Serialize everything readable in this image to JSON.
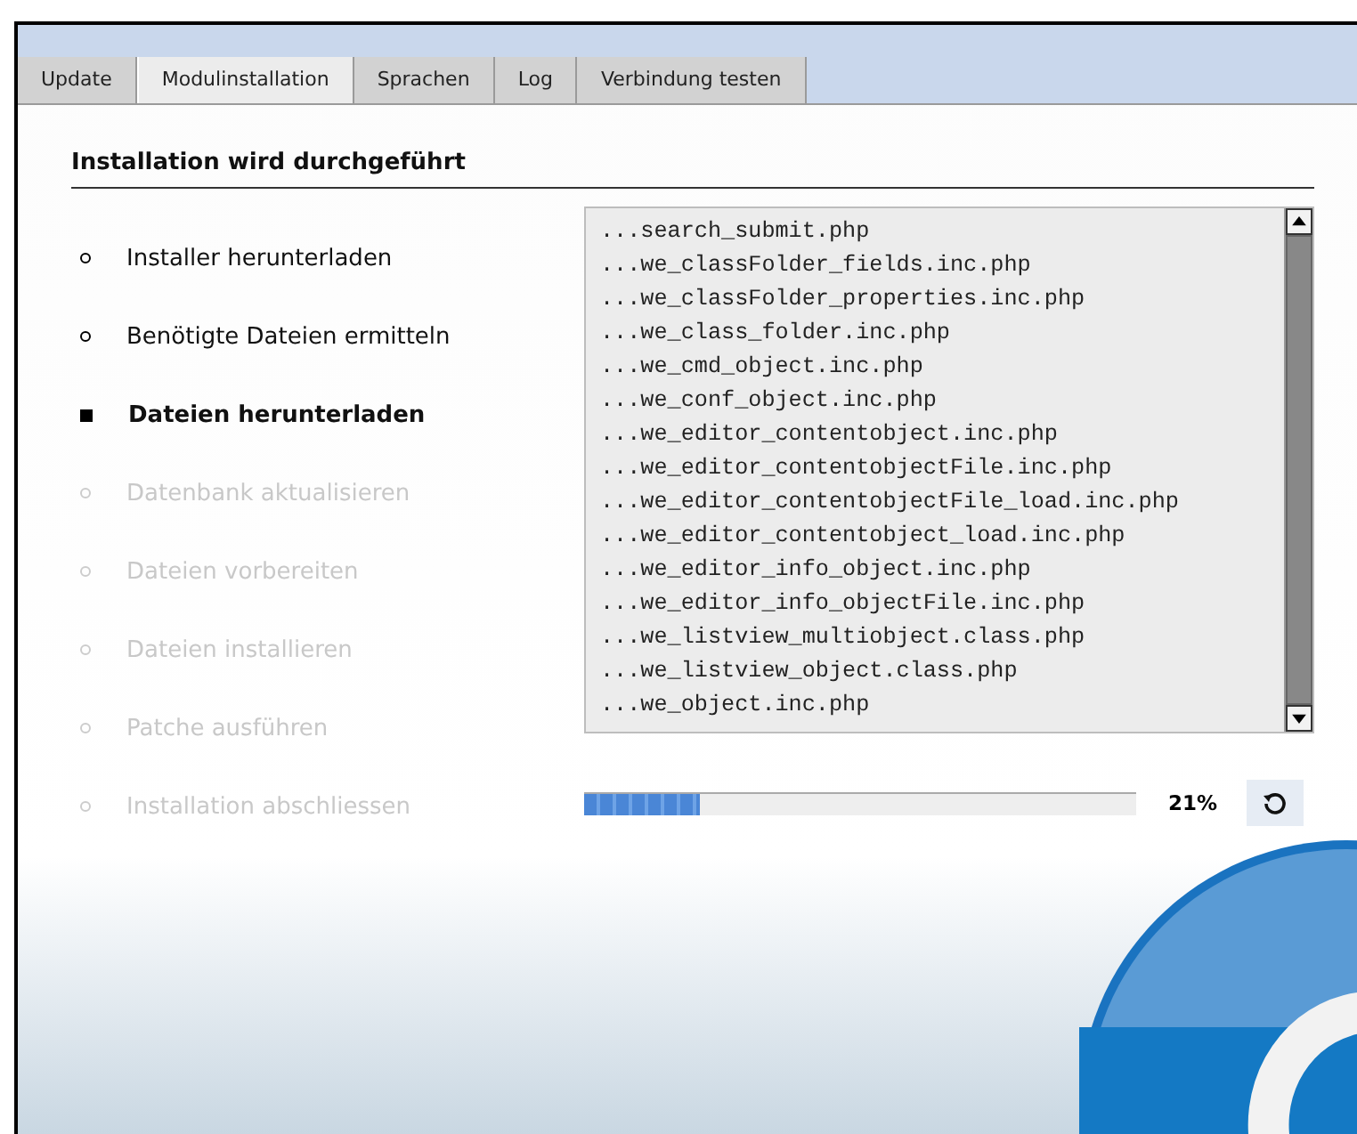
{
  "tabs": [
    {
      "label": "Update",
      "selected": false
    },
    {
      "label": "Modulinstallation",
      "selected": true
    },
    {
      "label": "Sprachen",
      "selected": false
    },
    {
      "label": "Log",
      "selected": false
    },
    {
      "label": "Verbindung testen",
      "selected": false
    }
  ],
  "heading": "Installation wird durchgeführt",
  "steps": [
    {
      "label": "Installer herunterladen",
      "kind": "done"
    },
    {
      "label": "Benötigte Dateien ermitteln",
      "kind": "done"
    },
    {
      "label": "Dateien herunterladen",
      "kind": "active"
    },
    {
      "label": "Datenbank aktualisieren",
      "kind": "pending"
    },
    {
      "label": "Dateien vorbereiten",
      "kind": "pending"
    },
    {
      "label": "Dateien installieren",
      "kind": "pending"
    },
    {
      "label": "Patche ausführen",
      "kind": "pending"
    },
    {
      "label": "Installation abschliessen",
      "kind": "pending"
    }
  ],
  "log_lines": [
    "...search_submit.php",
    "...we_classFolder_fields.inc.php",
    "...we_classFolder_properties.inc.php",
    "...we_class_folder.inc.php",
    "...we_cmd_object.inc.php",
    "...we_conf_object.inc.php",
    "...we_editor_contentobject.inc.php",
    "...we_editor_contentobjectFile.inc.php",
    "...we_editor_contentobjectFile_load.inc.php",
    "...we_editor_contentobject_load.inc.php",
    "...we_editor_info_object.inc.php",
    "...we_editor_info_objectFile.inc.php",
    "...we_listview_multiobject.class.php",
    "...we_listview_object.class.php",
    "...we_object.inc.php"
  ],
  "progress": {
    "level": 0.21,
    "reading": "21%"
  }
}
